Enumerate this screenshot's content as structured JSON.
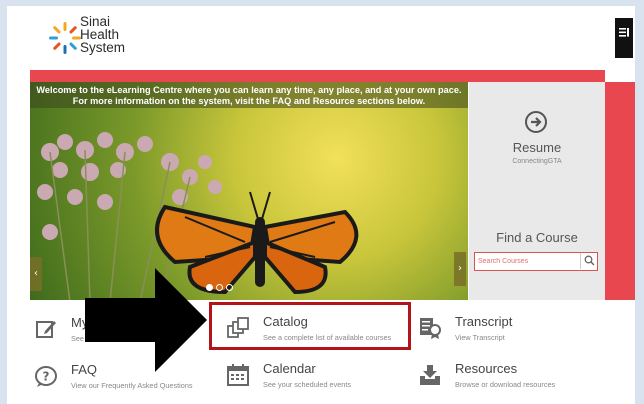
{
  "header": {
    "brand_lines": [
      "Sinai",
      "Health",
      "System"
    ]
  },
  "slider": {
    "banner_line1": "Welcome to the eLearning Centre where you can learn any time, any place, and at your own pace.",
    "banner_line2": "For more information on the system, visit the FAQ and Resource sections below.",
    "prev_glyph": "‹",
    "next_glyph": "›"
  },
  "side_panel": {
    "resume_label": "Resume",
    "resume_course": "ConnectingGTA",
    "find_label": "Find a Course",
    "search_placeholder": "Search Courses"
  },
  "nav": {
    "my_title": "My",
    "my_sub": "See",
    "catalog_title": "Catalog",
    "catalog_sub": "See a complete list of available courses",
    "transcript_title": "Transcript",
    "transcript_sub": "View Transcript",
    "faq_title": "FAQ",
    "faq_sub": "View our Frequently Asked Questions",
    "calendar_title": "Calendar",
    "calendar_sub": "See your scheduled events",
    "resources_title": "Resources",
    "resources_sub": "Browse or download resources"
  },
  "colors": {
    "accent_red": "#e8474f",
    "highlight_red": "#b3141a",
    "panel_gray": "#e9e9e9",
    "icon_gray": "#666666"
  },
  "icons": [
    "sinai-logo-icon",
    "menu-icon",
    "arrow-right-circle-icon",
    "search-icon",
    "edit-icon",
    "catalog-icon",
    "transcript-icon",
    "question-icon",
    "calendar-icon",
    "download-icon",
    "pointer-arrow-icon"
  ]
}
